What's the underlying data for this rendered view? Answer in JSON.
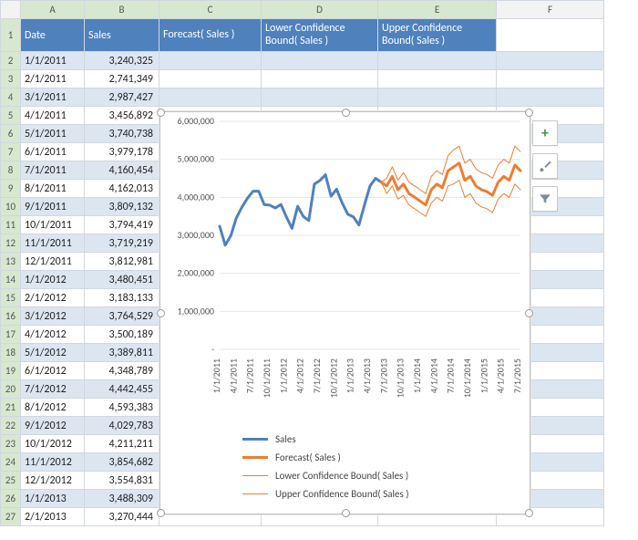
{
  "columns": [
    "",
    "A",
    "B",
    "C",
    "D",
    "E",
    "F"
  ],
  "headers": {
    "A": "Date",
    "B": "Sales",
    "C": "Forecast( Sales )",
    "D": "Lower Confidence Bound( Sales )",
    "E": "Upper Confidence Bound( Sales )"
  },
  "rows": [
    {
      "n": 2,
      "date": "1/1/2011",
      "sales": "3,240,325"
    },
    {
      "n": 3,
      "date": "2/1/2011",
      "sales": "2,741,349"
    },
    {
      "n": 4,
      "date": "3/1/2011",
      "sales": "2,987,427"
    },
    {
      "n": 5,
      "date": "4/1/2011",
      "sales": "3,456,892"
    },
    {
      "n": 6,
      "date": "5/1/2011",
      "sales": "3,740,738"
    },
    {
      "n": 7,
      "date": "6/1/2011",
      "sales": "3,979,178"
    },
    {
      "n": 8,
      "date": "7/1/2011",
      "sales": "4,160,454"
    },
    {
      "n": 9,
      "date": "8/1/2011",
      "sales": "4,162,013"
    },
    {
      "n": 10,
      "date": "9/1/2011",
      "sales": "3,809,132"
    },
    {
      "n": 11,
      "date": "10/1/2011",
      "sales": "3,794,419"
    },
    {
      "n": 12,
      "date": "11/1/2011",
      "sales": "3,719,219"
    },
    {
      "n": 13,
      "date": "12/1/2011",
      "sales": "3,812,981"
    },
    {
      "n": 14,
      "date": "1/1/2012",
      "sales": "3,480,451"
    },
    {
      "n": 15,
      "date": "2/1/2012",
      "sales": "3,183,133"
    },
    {
      "n": 16,
      "date": "3/1/2012",
      "sales": "3,764,529"
    },
    {
      "n": 17,
      "date": "4/1/2012",
      "sales": "3,500,189"
    },
    {
      "n": 18,
      "date": "5/1/2012",
      "sales": "3,389,811"
    },
    {
      "n": 19,
      "date": "6/1/2012",
      "sales": "4,348,789"
    },
    {
      "n": 20,
      "date": "7/1/2012",
      "sales": "4,442,455"
    },
    {
      "n": 21,
      "date": "8/1/2012",
      "sales": "4,593,383"
    },
    {
      "n": 22,
      "date": "9/1/2012",
      "sales": "4,029,783"
    },
    {
      "n": 23,
      "date": "10/1/2012",
      "sales": "4,211,211"
    },
    {
      "n": 24,
      "date": "11/1/2012",
      "sales": "3,854,682"
    },
    {
      "n": 25,
      "date": "12/1/2012",
      "sales": "3,554,831"
    },
    {
      "n": 26,
      "date": "1/1/2013",
      "sales": "3,488,309"
    },
    {
      "n": 27,
      "date": "2/1/2013",
      "sales": "3,270,444"
    }
  ],
  "tools": {
    "plus": "+",
    "brush": "brush",
    "funnel": "filter"
  },
  "legend": [
    "Sales",
    "Forecast( Sales )",
    "Lower Confidence Bound( Sales )",
    "Upper Confidence Bound( Sales )"
  ],
  "chart_data": {
    "type": "line",
    "xlabel": "",
    "ylabel": "",
    "ylim": [
      0,
      6000000
    ],
    "yticks": [
      "-",
      "1,000,000",
      "2,000,000",
      "3,000,000",
      "4,000,000",
      "5,000,000",
      "6,000,000"
    ],
    "xticks": [
      "1/1/2011",
      "4/1/2011",
      "7/1/2011",
      "10/1/2011",
      "1/1/2012",
      "4/1/2012",
      "7/1/2012",
      "10/1/2012",
      "1/1/2013",
      "4/1/2013",
      "7/1/2013",
      "10/1/2013",
      "1/1/2014",
      "4/1/2014",
      "7/1/2014",
      "10/1/2014",
      "1/1/2015",
      "4/1/2015",
      "7/1/2015"
    ],
    "x": [
      "1/1/2011",
      "2/1/2011",
      "3/1/2011",
      "4/1/2011",
      "5/1/2011",
      "6/1/2011",
      "7/1/2011",
      "8/1/2011",
      "9/1/2011",
      "10/1/2011",
      "11/1/2011",
      "12/1/2011",
      "1/1/2012",
      "2/1/2012",
      "3/1/2012",
      "4/1/2012",
      "5/1/2012",
      "6/1/2012",
      "7/1/2012",
      "8/1/2012",
      "9/1/2012",
      "10/1/2012",
      "11/1/2012",
      "12/1/2012",
      "1/1/2013",
      "2/1/2013",
      "3/1/2013",
      "4/1/2013",
      "5/1/2013",
      "6/1/2013",
      "7/1/2013",
      "8/1/2013",
      "9/1/2013",
      "10/1/2013",
      "11/1/2013",
      "12/1/2013",
      "1/1/2014",
      "2/1/2014",
      "3/1/2014",
      "4/1/2014",
      "5/1/2014",
      "6/1/2014",
      "7/1/2014",
      "8/1/2014",
      "9/1/2014",
      "10/1/2014",
      "11/1/2014",
      "12/1/2014",
      "1/1/2015",
      "2/1/2015",
      "3/1/2015",
      "4/1/2015",
      "5/1/2015",
      "6/1/2015",
      "7/1/2015"
    ],
    "series": [
      {
        "name": "Sales",
        "color": "#4f81bd",
        "width": 3,
        "values": [
          3240325,
          2741349,
          2987427,
          3456892,
          3740738,
          3979178,
          4160454,
          4162013,
          3809132,
          3794419,
          3719219,
          3812981,
          3480451,
          3183133,
          3764529,
          3500189,
          3389811,
          4348789,
          4442455,
          4593383,
          4029783,
          4211211,
          3854682,
          3554831,
          3488309,
          3270444,
          3800000,
          4300000,
          4500000,
          4400000,
          null,
          null,
          null,
          null,
          null,
          null,
          null,
          null,
          null,
          null,
          null,
          null,
          null,
          null,
          null,
          null,
          null,
          null,
          null,
          null,
          null,
          null,
          null,
          null,
          null
        ]
      },
      {
        "name": "Forecast( Sales )",
        "color": "#ed7d31",
        "width": 3,
        "values": [
          null,
          null,
          null,
          null,
          null,
          null,
          null,
          null,
          null,
          null,
          null,
          null,
          null,
          null,
          null,
          null,
          null,
          null,
          null,
          null,
          null,
          null,
          null,
          null,
          null,
          null,
          null,
          null,
          null,
          4400000,
          4300000,
          4550000,
          4200000,
          4350000,
          4100000,
          4000000,
          3900000,
          3800000,
          4200000,
          4350000,
          4250000,
          4700000,
          4800000,
          4900000,
          4450000,
          4550000,
          4300000,
          4200000,
          4150000,
          4050000,
          4400000,
          4550000,
          4450000,
          4850000,
          4700000
        ]
      },
      {
        "name": "Lower Confidence Bound( Sales )",
        "color": "#ed7d31",
        "width": 1,
        "values": [
          null,
          null,
          null,
          null,
          null,
          null,
          null,
          null,
          null,
          null,
          null,
          null,
          null,
          null,
          null,
          null,
          null,
          null,
          null,
          null,
          null,
          null,
          null,
          null,
          null,
          null,
          null,
          null,
          null,
          4400000,
          4100000,
          4300000,
          3950000,
          4050000,
          3800000,
          3700000,
          3600000,
          3500000,
          3850000,
          4000000,
          3900000,
          4300000,
          4350000,
          4450000,
          4000000,
          4100000,
          3850000,
          3750000,
          3700000,
          3600000,
          3950000,
          4100000,
          4000000,
          4350000,
          4200000
        ]
      },
      {
        "name": "Upper Confidence Bound( Sales )",
        "color": "#ed7d31",
        "width": 1,
        "values": [
          null,
          null,
          null,
          null,
          null,
          null,
          null,
          null,
          null,
          null,
          null,
          null,
          null,
          null,
          null,
          null,
          null,
          null,
          null,
          null,
          null,
          null,
          null,
          null,
          null,
          null,
          null,
          null,
          null,
          4400000,
          4500000,
          4800000,
          4450000,
          4650000,
          4400000,
          4300000,
          4200000,
          4100000,
          4550000,
          4700000,
          4600000,
          5100000,
          5250000,
          5350000,
          4900000,
          5000000,
          4750000,
          4650000,
          4600000,
          4500000,
          4850000,
          5000000,
          4900000,
          5350000,
          5200000
        ]
      }
    ]
  }
}
